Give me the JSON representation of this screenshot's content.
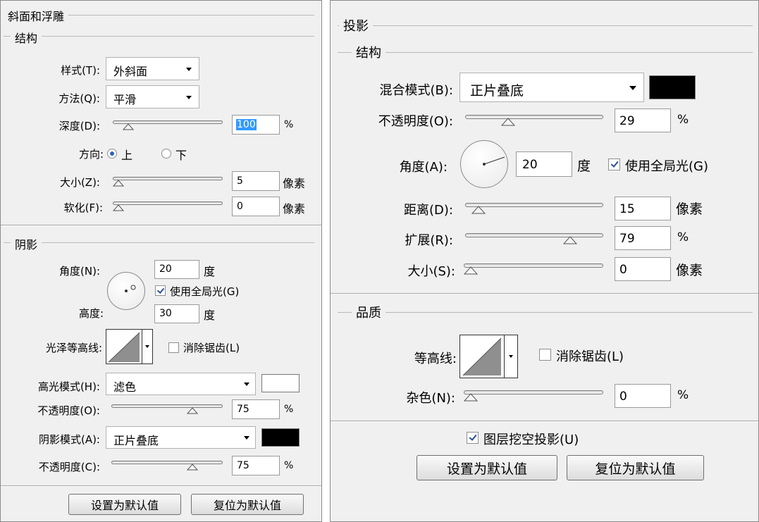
{
  "left_panel": {
    "title": "斜面和浮雕",
    "structure": {
      "title": "结构",
      "style": {
        "label": "样式(T):",
        "value": "外斜面"
      },
      "technique": {
        "label": "方法(Q):",
        "value": "平滑"
      },
      "depth": {
        "label": "深度(D):",
        "value": "100",
        "unit": "%",
        "slider_fraction": 0.1
      },
      "direction": {
        "label": "方向:",
        "up": "上",
        "down": "下",
        "selected": "上"
      },
      "size": {
        "label": "大小(Z):",
        "value": "5",
        "unit": "像素",
        "slider_fraction": 0.0
      },
      "soften": {
        "label": "软化(F):",
        "value": "0",
        "unit": "像素",
        "slider_fraction": 0.0
      }
    },
    "shading": {
      "title": "阴影",
      "angle": {
        "label": "角度(N):",
        "value": "20",
        "unit": "度"
      },
      "use_global_light": {
        "label": "使用全局光(G)",
        "checked": true
      },
      "altitude": {
        "label": "高度:",
        "value": "30",
        "unit": "度"
      },
      "gloss_contour": {
        "label": "光泽等高线:"
      },
      "anti_aliased": {
        "label": "消除锯齿(L)",
        "checked": false
      },
      "highlight_mode": {
        "label": "高光模式(H):",
        "value": "滤色",
        "color": "#ffffff"
      },
      "highlight_opacity": {
        "label": "不透明度(O):",
        "value": "75",
        "unit": "%",
        "slider_fraction": 0.75
      },
      "shadow_mode": {
        "label": "阴影模式(A):",
        "value": "正片叠底",
        "color": "#000000"
      },
      "shadow_opacity": {
        "label": "不透明度(C):",
        "value": "75",
        "unit": "%",
        "slider_fraction": 0.75
      }
    },
    "buttons": {
      "make_default": "设置为默认值",
      "reset_default": "复位为默认值"
    }
  },
  "right_panel": {
    "title": "投影",
    "structure": {
      "title": "结构",
      "blend_mode": {
        "label": "混合模式(B):",
        "value": "正片叠底",
        "color": "#000000"
      },
      "opacity": {
        "label": "不透明度(O):",
        "value": "29",
        "unit": "%",
        "slider_fraction": 0.29
      },
      "angle": {
        "label": "角度(A):",
        "value": "20",
        "unit": "度"
      },
      "use_global_light": {
        "label": "使用全局光(G)",
        "checked": true
      },
      "distance": {
        "label": "距离(D):",
        "value": "15",
        "unit": "像素",
        "slider_fraction": 0.05
      },
      "spread": {
        "label": "扩展(R):",
        "value": "79",
        "unit": "%",
        "slider_fraction": 0.79
      },
      "size": {
        "label": "大小(S):",
        "value": "0",
        "unit": "像素",
        "slider_fraction": 0.0
      }
    },
    "quality": {
      "title": "品质",
      "contour": {
        "label": "等高线:"
      },
      "anti_aliased": {
        "label": "消除锯齿(L)",
        "checked": false
      },
      "noise": {
        "label": "杂色(N):",
        "value": "0",
        "unit": "%",
        "slider_fraction": 0.0
      }
    },
    "layer_knocks_out": {
      "label": "图层挖空投影(U)",
      "checked": true
    },
    "buttons": {
      "make_default": "设置为默认值",
      "reset_default": "复位为默认值"
    }
  }
}
